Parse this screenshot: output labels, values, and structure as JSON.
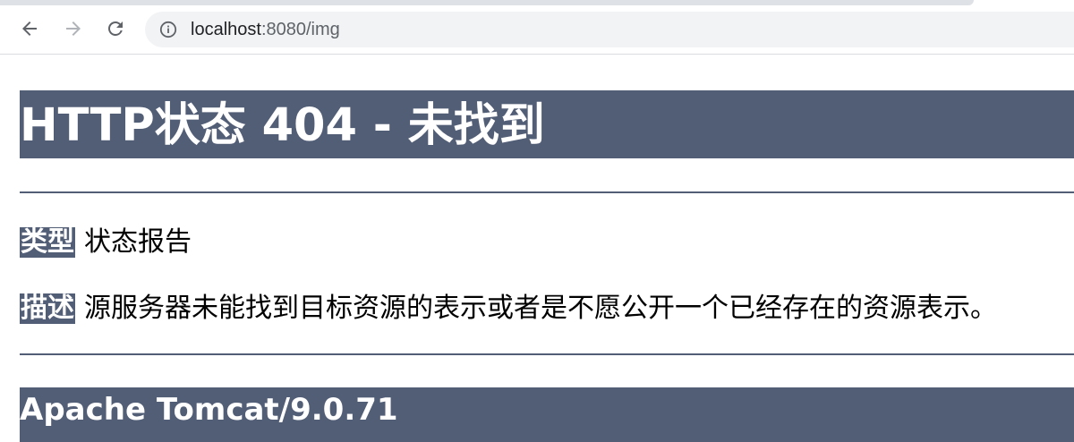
{
  "browser": {
    "url_host": "localhost",
    "url_rest": ":8080/img",
    "icons": {
      "back": "arrow-left-icon",
      "forward": "arrow-right-icon",
      "reload": "reload-icon",
      "site_info": "info-icon"
    }
  },
  "page": {
    "title": "HTTP状态 404 - 未找到",
    "type_label": "类型",
    "type_value": "状态报告",
    "description_label": "描述",
    "description_value": "源服务器未能找到目标资源的表示或者是不愿公开一个已经存在的资源表示。",
    "server": "Apache Tomcat/9.0.71"
  },
  "colors": {
    "accent": "#525d76",
    "background": "#ffffff",
    "omnibox": "#f1f3f4"
  }
}
